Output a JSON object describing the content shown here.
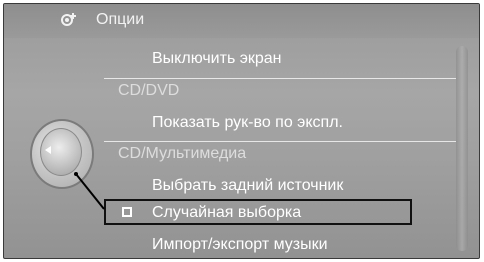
{
  "header": {
    "title": "Опции",
    "icon": "settings-gear-icon"
  },
  "menu": {
    "items": [
      {
        "type": "item",
        "label": "Выключить экран"
      },
      {
        "type": "section",
        "label": "CD/DVD"
      },
      {
        "type": "item",
        "label": "Показать рук-во по экспл."
      },
      {
        "type": "section",
        "label": "CD/Мультимедиа"
      },
      {
        "type": "item",
        "label": "Выбрать задний источник"
      },
      {
        "type": "checkbox-item",
        "label": "Случайная выборка",
        "checked": false
      },
      {
        "type": "item",
        "label": "Импорт/экспорт музыки"
      }
    ]
  }
}
